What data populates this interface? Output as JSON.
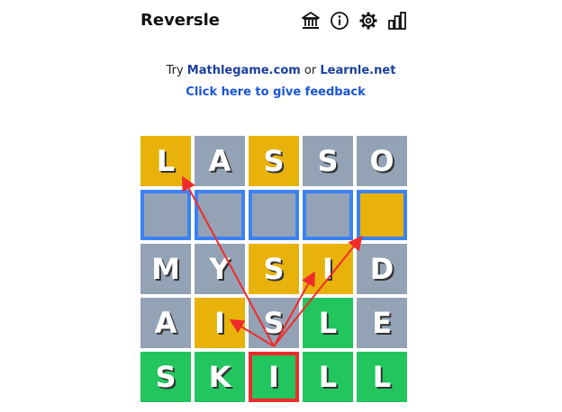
{
  "header": {
    "title": "Reversle"
  },
  "icons": [
    "bank-icon",
    "info-icon",
    "gear-icon",
    "stats-icon"
  ],
  "promo": {
    "prefix": "Try ",
    "link1": "Mathlegame.com",
    "middle": " or ",
    "link2": "Learnle.net"
  },
  "feedback": "Click here to give feedback",
  "colors": {
    "gray": "#93a3b5",
    "yellow": "#e8b20a",
    "green": "#22c55e",
    "empty_border": "#3b82f6",
    "selected_border": "#ef2b2b",
    "arrow": "#ef2b2b"
  },
  "board": {
    "rows": [
      [
        {
          "letter": "L",
          "state": "yellow"
        },
        {
          "letter": "A",
          "state": "gray"
        },
        {
          "letter": "S",
          "state": "yellow"
        },
        {
          "letter": "S",
          "state": "gray"
        },
        {
          "letter": "O",
          "state": "gray"
        }
      ],
      [
        {
          "letter": "",
          "state": "gray",
          "empty": true
        },
        {
          "letter": "",
          "state": "gray",
          "empty": true
        },
        {
          "letter": "",
          "state": "gray",
          "empty": true
        },
        {
          "letter": "",
          "state": "gray",
          "empty": true
        },
        {
          "letter": "",
          "state": "yellow",
          "empty": true
        }
      ],
      [
        {
          "letter": "M",
          "state": "gray"
        },
        {
          "letter": "Y",
          "state": "gray"
        },
        {
          "letter": "S",
          "state": "yellow"
        },
        {
          "letter": "I",
          "state": "yellow"
        },
        {
          "letter": "D",
          "state": "gray"
        }
      ],
      [
        {
          "letter": "A",
          "state": "gray"
        },
        {
          "letter": "I",
          "state": "yellow"
        },
        {
          "letter": "S",
          "state": "gray"
        },
        {
          "letter": "L",
          "state": "green"
        },
        {
          "letter": "E",
          "state": "gray"
        }
      ],
      [
        {
          "letter": "S",
          "state": "green"
        },
        {
          "letter": "K",
          "state": "green"
        },
        {
          "letter": "I",
          "state": "green",
          "selected": true
        },
        {
          "letter": "L",
          "state": "green"
        },
        {
          "letter": "L",
          "state": "green"
        }
      ]
    ],
    "arrows_from": {
      "row": 4,
      "col": 2
    },
    "arrows_to": [
      {
        "row": 0,
        "col": 0
      },
      {
        "row": 1,
        "col": 4
      },
      {
        "row": 2,
        "col": 3
      },
      {
        "row": 3,
        "col": 1
      }
    ]
  }
}
